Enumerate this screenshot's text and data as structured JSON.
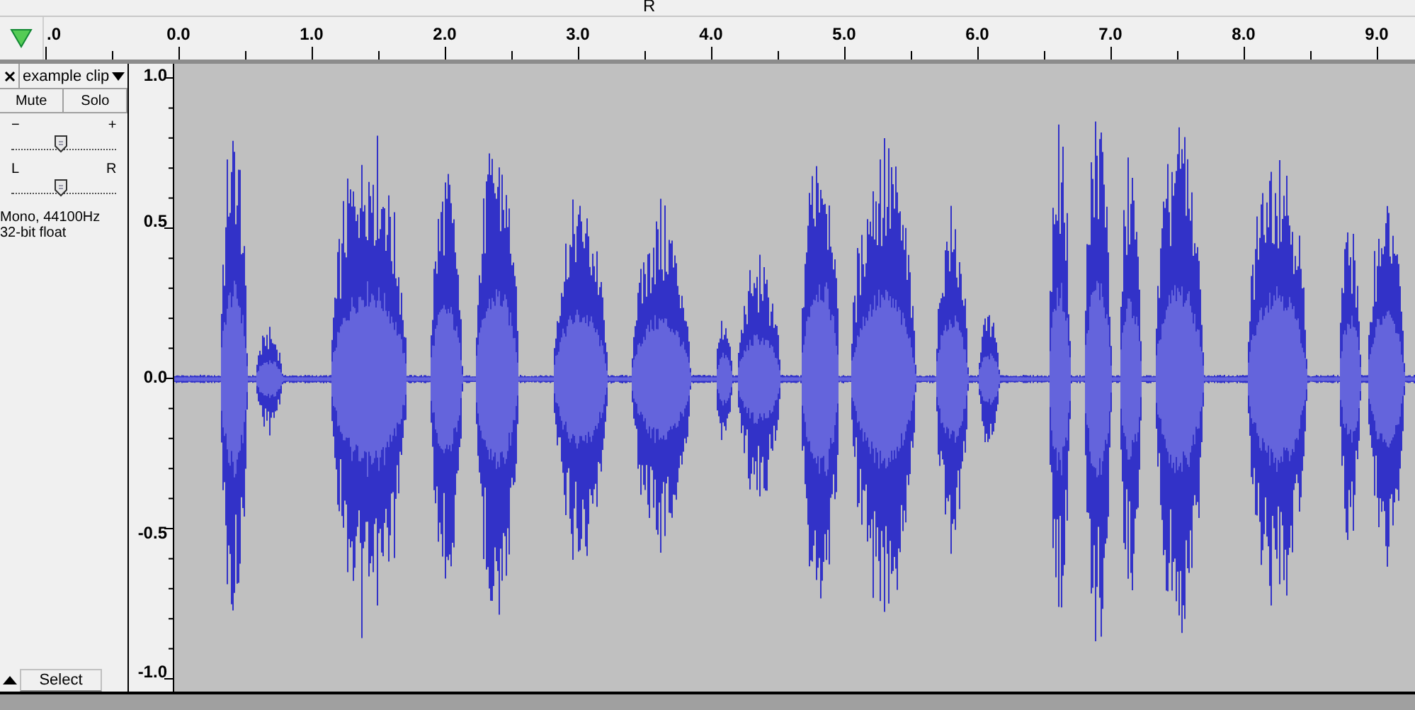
{
  "toolbar": {
    "channel_label": "R"
  },
  "ruler": {
    "labels": [
      ".0",
      "0.0",
      "1.0",
      "2.0",
      "3.0",
      "4.0",
      "5.0",
      "6.0",
      "7.0",
      "8.0",
      "9.0"
    ]
  },
  "track": {
    "name": "example clip",
    "mute": "Mute",
    "solo": "Solo",
    "gain": {
      "min_label": "−",
      "max_label": "+",
      "level": 0.47
    },
    "pan": {
      "min_label": "L",
      "max_label": "R",
      "level": 0.47
    },
    "info": [
      "Mono, 44100Hz",
      "32-bit float"
    ],
    "select": "Select"
  },
  "amplitude_axis": {
    "labels": [
      "1.0",
      "0.5",
      "0.0",
      "-0.5",
      "-1.0"
    ]
  }
}
